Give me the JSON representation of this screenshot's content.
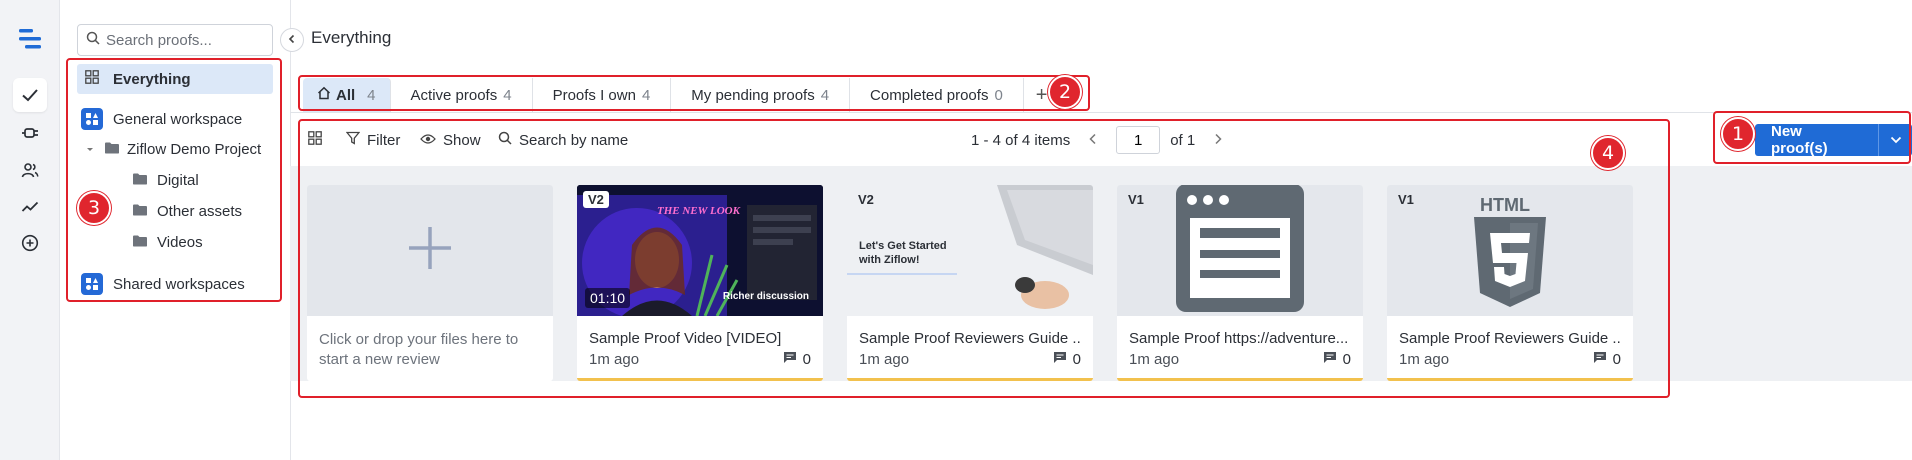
{
  "rail": {
    "icons": [
      "logo-icon",
      "check-icon",
      "plug-icon",
      "users-icon",
      "activity-icon",
      "add-circle-icon"
    ]
  },
  "sidebar": {
    "search_placeholder": "Search proofs...",
    "everything": "Everything",
    "general_workspace": "General workspace",
    "project": "Ziflow Demo Project",
    "folders": [
      "Digital",
      "Other assets",
      "Videos"
    ],
    "shared_workspaces": "Shared workspaces"
  },
  "header": {
    "title": "Everything"
  },
  "tabs": [
    {
      "label": "All",
      "count": "4"
    },
    {
      "label": "Active proofs",
      "count": "4"
    },
    {
      "label": "Proofs I own",
      "count": "4"
    },
    {
      "label": "My pending proofs",
      "count": "4"
    },
    {
      "label": "Completed proofs",
      "count": "0"
    }
  ],
  "tab_add": "+",
  "toolbar": {
    "filter": "Filter",
    "show": "Show",
    "search": "Search by name",
    "range": "1 - 4 of 4 items",
    "page": "1",
    "of": "of 1"
  },
  "new_button": {
    "label": "New proof(s)"
  },
  "drop_card": {
    "text": "Click or drop your files here to start a new review"
  },
  "cards": [
    {
      "version": "V2",
      "name": "Sample Proof Video [VIDEO]",
      "time": "1m ago",
      "comments": "0",
      "duration": "01:10",
      "headline": "THE NEW LOOK",
      "caption": "Richer discussion"
    },
    {
      "version": "V2",
      "name": "Sample Proof Reviewers Guide ...",
      "time": "1m ago",
      "comments": "0",
      "thumb_text": "Let's Get Started with Ziflow!"
    },
    {
      "version": "V1",
      "name": "Sample Proof https://adventure...",
      "time": "1m ago",
      "comments": "0"
    },
    {
      "version": "V1",
      "name": "Sample Proof Reviewers Guide ...",
      "time": "1m ago",
      "comments": "0",
      "thumb_text": "HTML"
    }
  ],
  "markers": [
    "1",
    "2",
    "3",
    "4"
  ],
  "colors": {
    "accent": "#1f6bd6",
    "annotation": "#e0202a",
    "status_bar": "#f2c14e",
    "tab_active": "#dce8f8"
  }
}
